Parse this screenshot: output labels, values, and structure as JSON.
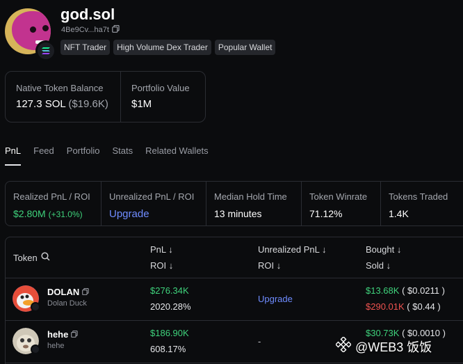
{
  "profile": {
    "name": "god.sol",
    "address": "4Be9Cv...ha7t",
    "tags": [
      "NFT Trader",
      "High Volume Dex Trader",
      "Popular Wallet"
    ]
  },
  "balance": {
    "native_label": "Native Token Balance",
    "native_value": "127.3 SOL",
    "native_usd": "($19.6K)",
    "portfolio_label": "Portfolio Value",
    "portfolio_value": "$1M"
  },
  "tabs": [
    "PnL",
    "Feed",
    "Portfolio",
    "Stats",
    "Related Wallets"
  ],
  "stats": {
    "realized_label": "Realized PnL / ROI",
    "realized_value": "$2.80M",
    "realized_roi": "(+31.0%)",
    "unrealized_label": "Unrealized PnL / ROI",
    "unrealized_value": "Upgrade",
    "hold_label": "Median Hold Time",
    "hold_value": "13 minutes",
    "winrate_label": "Token Winrate",
    "winrate_value": "71.12%",
    "traded_label": "Tokens Traded",
    "traded_value": "1.4K"
  },
  "table": {
    "headers": {
      "token": "Token",
      "pnl": "PnL ↓",
      "roi": "ROI ↓",
      "unrealized_pnl": "Unrealized PnL ↓",
      "unrealized_roi": "ROI ↓",
      "bought": "Bought ↓",
      "sold": "Sold ↓"
    },
    "rows": [
      {
        "name": "DOLAN",
        "sub": "Dolan Duck",
        "pnl": "$276.34K",
        "roi": "2020.28%",
        "unrealized": "Upgrade",
        "bought": "$13.68K",
        "bought_price": "( $0.0211 )",
        "sold": "$290.01K",
        "sold_price": "( $0.44 )"
      },
      {
        "name": "hehe",
        "sub": "hehe",
        "pnl": "$186.90K",
        "roi": "608.17%",
        "unrealized": "-",
        "bought": "$30.73K",
        "bought_price": "( $0.0010 )"
      }
    ]
  },
  "watermark": "@WEB3 饭饭",
  "colors": {
    "background": "#0b0c0e",
    "positive": "#3fd37c",
    "negative": "#ef5350",
    "link": "#6f8cff"
  }
}
